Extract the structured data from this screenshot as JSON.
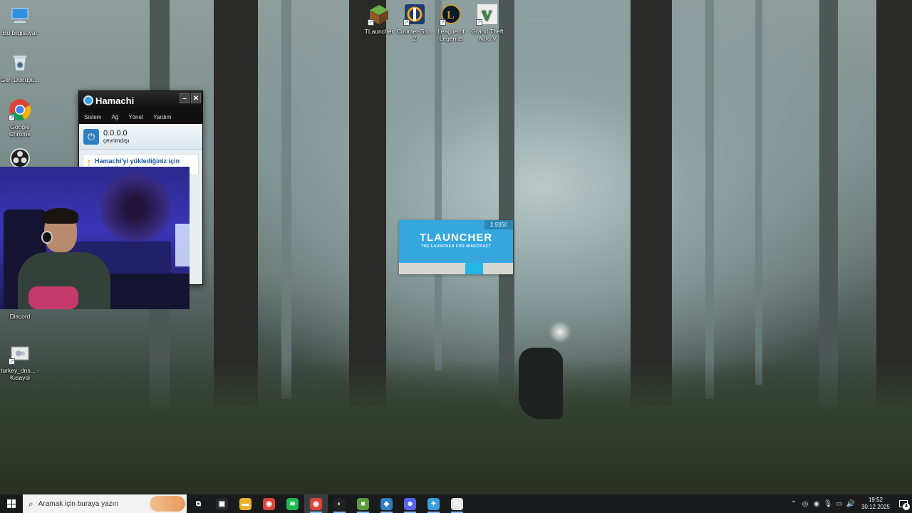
{
  "desktop": {
    "left_icons": [
      {
        "label": "Bu bilgisayar",
        "icon": "computer-icon"
      },
      {
        "label": "Geri Dönüşü...",
        "icon": "recycle-bin-icon"
      },
      {
        "label": "Google Chrome",
        "icon": "chrome-icon"
      },
      {
        "label": "Discord",
        "icon": "discord-icon"
      },
      {
        "label": "turkey_dns... - Kısayol",
        "icon": "shortcut-file-icon"
      }
    ],
    "top_icons": [
      {
        "label": "TLauncher",
        "icon": "tlauncher-icon"
      },
      {
        "label": "Counter-Str... 2",
        "icon": "counter-strike-icon"
      },
      {
        "label": "League of Legends",
        "icon": "league-of-legends-icon"
      },
      {
        "label": "Grand Theft Auto V",
        "icon": "gta-v-icon"
      }
    ]
  },
  "hamachi": {
    "title": "Hamachi",
    "menu": [
      "Sistem",
      "Ağ",
      "Yönet",
      "Yardım"
    ],
    "ip": "0.0.0.0",
    "status": "çevrimdışı",
    "notice": "Hamachi'yi yüklediğiniz için teşekkür ederiz"
  },
  "tlauncher_splash": {
    "version": "2.9350",
    "name": "TLAUNCHER",
    "tagline": "THE LAUNCHER FOR MINECRAFT",
    "progress_fraction": 0.16,
    "progress_offset_fraction": 0.58
  },
  "taskbar": {
    "search_placeholder": "Aramak için buraya yazın",
    "apps": [
      {
        "name": "task-view",
        "glyph": "⧉",
        "color": "#191a1c"
      },
      {
        "name": "store",
        "glyph": "▣",
        "color": "#2b2b2b"
      },
      {
        "name": "file-explorer",
        "glyph": "▬",
        "color": "#e8b430"
      },
      {
        "name": "chrome",
        "glyph": "◉",
        "color": "#db4437"
      },
      {
        "name": "spotify",
        "glyph": "≋",
        "color": "#1db954"
      },
      {
        "name": "chrome-active",
        "glyph": "◉",
        "color": "#db4437"
      },
      {
        "name": "obs",
        "glyph": "◐",
        "color": "#222"
      },
      {
        "name": "minecraft",
        "glyph": "■",
        "color": "#5a9a3a"
      },
      {
        "name": "hamachi",
        "glyph": "◈",
        "color": "#2d7fc0"
      },
      {
        "name": "discord",
        "glyph": "☻",
        "color": "#5865f2"
      },
      {
        "name": "hamachi-network",
        "glyph": "✦",
        "color": "#3aa0e0"
      },
      {
        "name": "java",
        "glyph": "♨",
        "color": "#e8e8e8"
      }
    ],
    "time": "19:52",
    "date": "30.12.2025",
    "notification_count": "4"
  }
}
